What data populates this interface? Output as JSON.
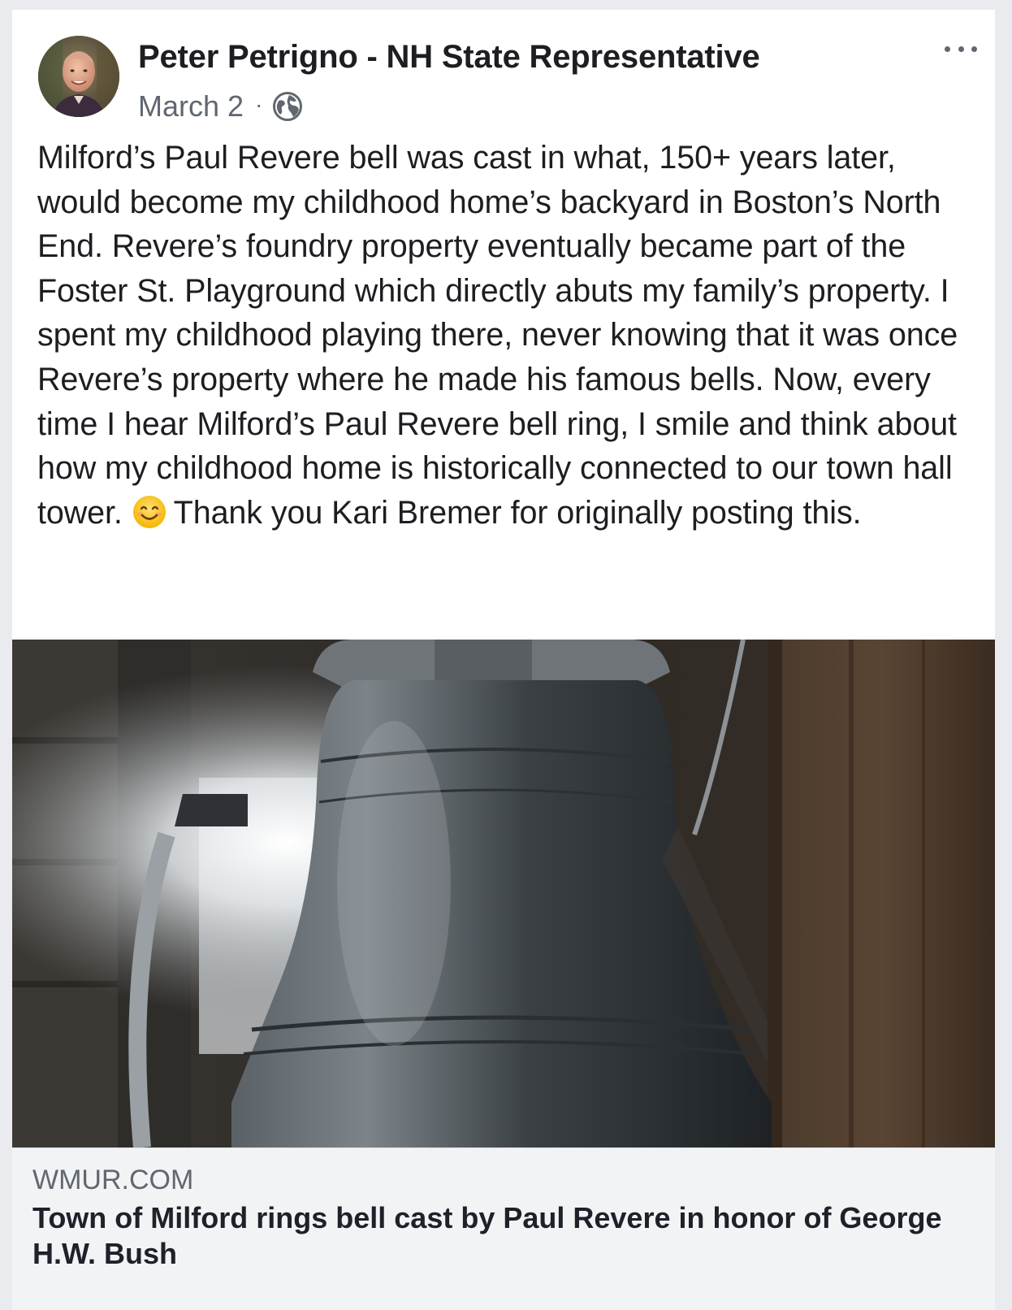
{
  "post": {
    "author": "Peter Petrigno - NH State Representative",
    "date": "March 2",
    "separator": "·",
    "privacy_icon": "globe-icon",
    "more_icon": "more-options-icon",
    "text_before_emoji": "Milford’s Paul Revere bell was cast in what, 150+ years later, would become my childhood home’s backyard in Boston’s North End. Revere’s foundry property eventually became part of the Foster St. Playground which directly abuts my family’s property. I spent my childhood playing there, never knowing that it was once Revere’s property where he made his famous bells. Now, every time I hear Milford’s Paul Revere bell ring, I smile and think about how my childhood home is historically connected to our town hall tower. ",
    "emoji_icon": "smiling-face-emoji-icon",
    "text_after_emoji": "Thank you Kari Bremer for originally posting this."
  },
  "link": {
    "domain": "WMUR.COM",
    "title": "Town of Milford rings bell cast by Paul Revere in honor of George H.W. Bush"
  },
  "colors": {
    "page_background": "#e9ebee",
    "card_background": "#ffffff",
    "secondary_text": "#606770",
    "link_preview_background": "#f2f3f5"
  }
}
